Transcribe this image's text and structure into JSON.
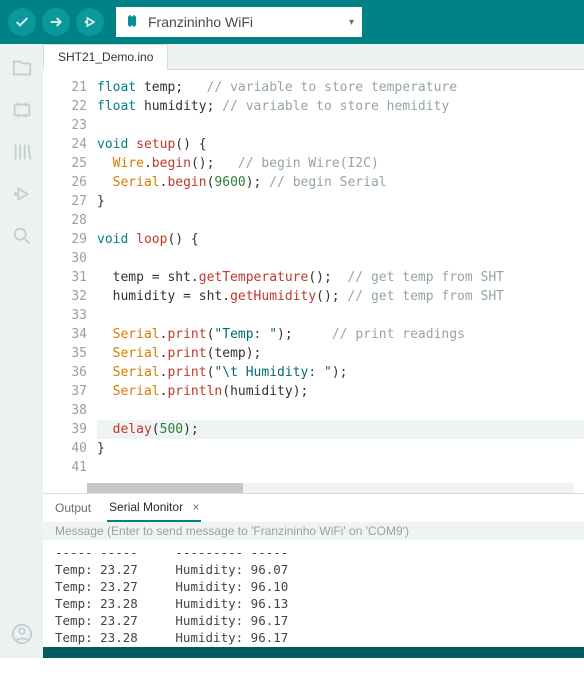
{
  "toolbar": {
    "board_label": "Franzininho WiFi"
  },
  "tab": {
    "filename": "SHT21_Demo.ino"
  },
  "editor": {
    "first_line_no": 21,
    "lines": [
      {
        "html": "<span class='k'>float</span> temp;   <span class='cm'>// variable to store temperature</span>"
      },
      {
        "html": "<span class='k'>float</span> humidity; <span class='cm'>// variable to store hemidity</span>"
      },
      {
        "html": ""
      },
      {
        "html": "<span class='k'>void</span> <span class='fn'>setup</span>() {"
      },
      {
        "html": "  <span class='idA'>Wire</span>.<span class='fn'>begin</span>();   <span class='cm'>// begin Wire(I2C)</span>"
      },
      {
        "html": "  <span class='idA'>Serial</span>.<span class='fn'>begin</span>(<span class='num'>9600</span>); <span class='cm'>// begin Serial</span>"
      },
      {
        "html": "}"
      },
      {
        "html": ""
      },
      {
        "html": "<span class='k'>void</span> <span class='fn'>loop</span>() {"
      },
      {
        "html": ""
      },
      {
        "html": "  temp = sht.<span class='fn'>getTemperature</span>();  <span class='cm'>// get temp from SHT</span>"
      },
      {
        "html": "  humidity = sht.<span class='fn'>getHumidity</span>(); <span class='cm'>// get temp from SHT</span>"
      },
      {
        "html": ""
      },
      {
        "html": "  <span class='idA'>Serial</span>.<span class='fn'>print</span>(<span class='str'>\"Temp: \"</span>);     <span class='cm'>// print readings</span>"
      },
      {
        "html": "  <span class='idA'>Serial</span>.<span class='fn'>print</span>(temp);"
      },
      {
        "html": "  <span class='idA'>Serial</span>.<span class='fn'>print</span>(<span class='str'>\"\\t Humidity: \"</span>);"
      },
      {
        "html": "  <span class='idA'>Serial</span>.<span class='fn'>println</span>(humidity);"
      },
      {
        "html": ""
      },
      {
        "html": "  <span class='fn'>delay</span>(<span class='num'>500</span>);",
        "hl": true
      },
      {
        "html": "}"
      },
      {
        "html": ""
      }
    ]
  },
  "panel": {
    "output_label": "Output",
    "monitor_label": "Serial Monitor",
    "close_glyph": "×",
    "input_placeholder": "Message (Enter to send message to 'Franzininho WiFi' on 'COM9')",
    "rows": [
      {
        "temp": "-----",
        "hum": "-----",
        "faded": true
      },
      {
        "temp": "23.27",
        "hum": "96.07"
      },
      {
        "temp": "23.27",
        "hum": "96.10"
      },
      {
        "temp": "23.28",
        "hum": "96.13"
      },
      {
        "temp": "23.27",
        "hum": "96.17"
      },
      {
        "temp": "23.28",
        "hum": "96.17"
      }
    ]
  }
}
